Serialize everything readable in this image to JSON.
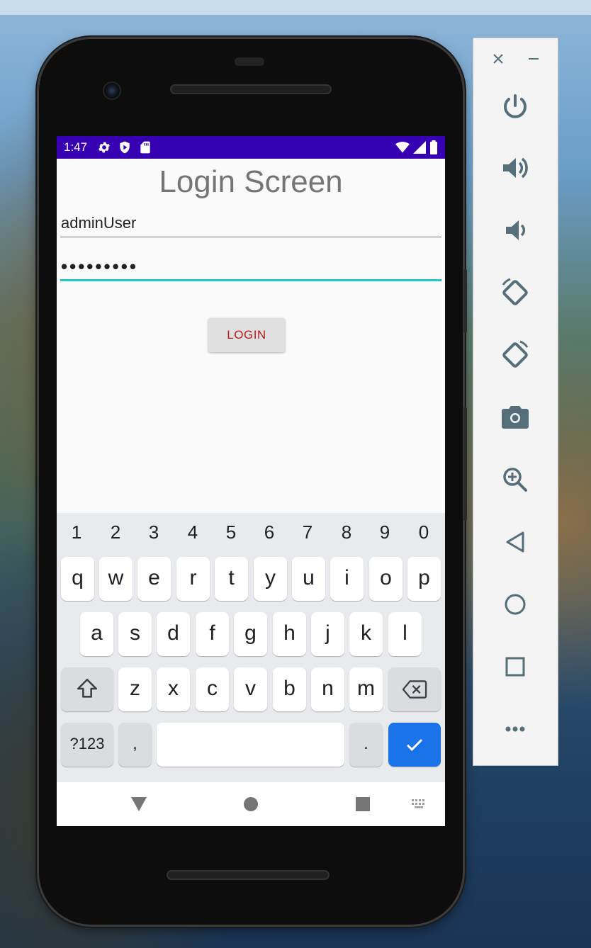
{
  "status_bar": {
    "time": "1:47"
  },
  "login": {
    "title": "Login Screen",
    "username": "adminUser",
    "password_masked": "•••••••••",
    "button_label": "LOGIN"
  },
  "keyboard": {
    "digits": [
      "1",
      "2",
      "3",
      "4",
      "5",
      "6",
      "7",
      "8",
      "9",
      "0"
    ],
    "row1": [
      "q",
      "w",
      "e",
      "r",
      "t",
      "y",
      "u",
      "i",
      "o",
      "p"
    ],
    "row2": [
      "a",
      "s",
      "d",
      "f",
      "g",
      "h",
      "j",
      "k",
      "l"
    ],
    "row3": [
      "z",
      "x",
      "c",
      "v",
      "b",
      "n",
      "m"
    ],
    "symbols_key": "?123",
    "comma_key": ",",
    "period_key": "."
  },
  "colors": {
    "status_bar": "#3700b3",
    "field_focus": "#26c6c6",
    "button_text": "#b71c1c",
    "enter_key": "#1a73e8",
    "toolbar_icon": "#546e7a"
  },
  "toolbar": {
    "items": [
      "close-icon",
      "minimize-icon",
      "power-icon",
      "volume-up-icon",
      "volume-down-icon",
      "rotate-left-icon",
      "rotate-right-icon",
      "camera-icon",
      "zoom-icon",
      "back-icon",
      "home-icon",
      "overview-icon",
      "more-icon"
    ]
  }
}
